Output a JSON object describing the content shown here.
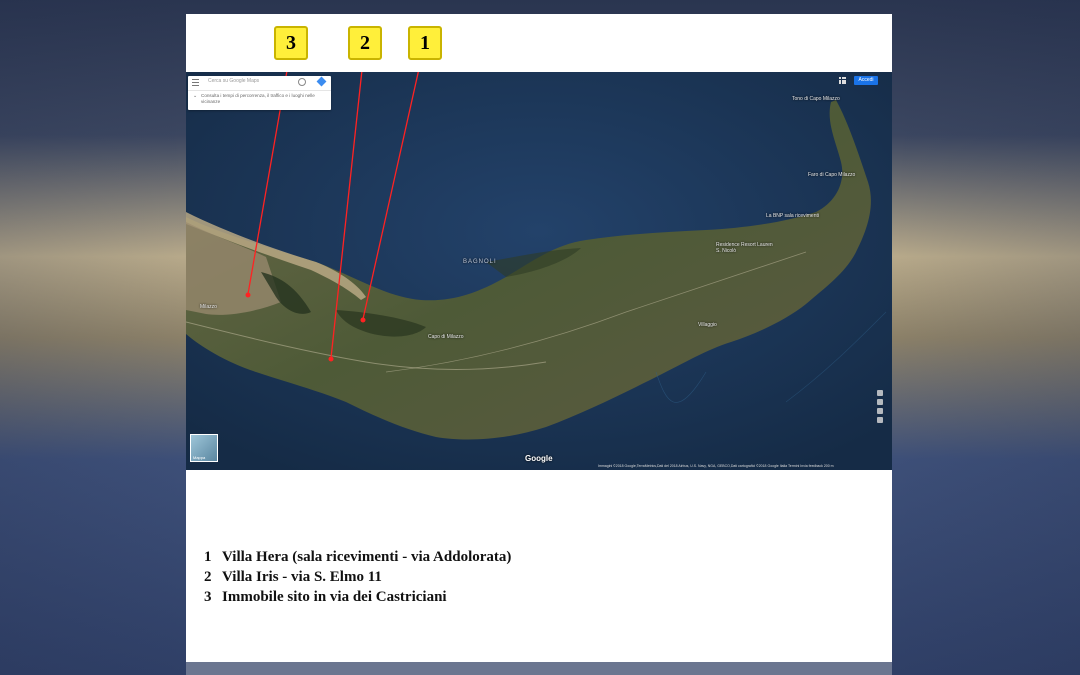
{
  "callouts": [
    {
      "number": "3"
    },
    {
      "number": "2"
    },
    {
      "number": "1"
    }
  ],
  "map": {
    "search_placeholder": "Cerca su Google Maps",
    "hint_text": "Consulta i tempi di percorrenza, il traffico e i luoghi nelle vicinanze",
    "signin_label": "Accedi",
    "labels": {
      "bagnoli": "BAGNOLI",
      "tono": "Tono di Capo Milazzo",
      "lighthouse": "Faro di Capo Milazzo",
      "sala": "La BNP sala ricevimenti",
      "residence": "Residence Resort Lauren S. Nicolò",
      "capo_milazzo": "Capo di Milazzo",
      "village": "Villaggio",
      "milazzo": "Milazzo"
    },
    "google_logo": "Google",
    "attribution": "Immagini ©2018 Google,TerraMetrics,Dati del 2018 Airbus, U.S. Navy, NGA, GEBCO,Dati cartografici ©2018 Google  Italia  Termini  Invia feedback  200 m",
    "satellite_label": "Mappa"
  },
  "legend": [
    {
      "number": "1",
      "text": "Villa Hera (sala ricevimenti - via Addolorata)"
    },
    {
      "number": "2",
      "text": "Villa Iris - via S. Elmo 11"
    },
    {
      "number": "3",
      "text": "Immobile sito in via dei Castriciani"
    }
  ],
  "colors": {
    "callout_fill": "#ffef3a",
    "marker_line": "#ff2222",
    "sea": "#1b3553",
    "land": "#4f5a3a"
  }
}
